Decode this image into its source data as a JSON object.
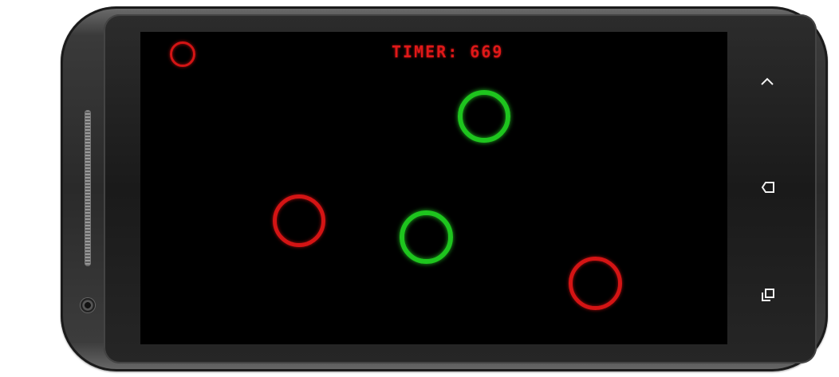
{
  "game": {
    "timer_label": "TIMER:",
    "timer_value": "669"
  },
  "colors": {
    "background": "#000000",
    "ring_red": "#d41414",
    "ring_green": "#1ec51e",
    "timer_text": "#e01818"
  },
  "nav": {
    "up_icon": "chevron-up-icon",
    "back_icon": "back-icon",
    "recents_icon": "recents-icon"
  }
}
